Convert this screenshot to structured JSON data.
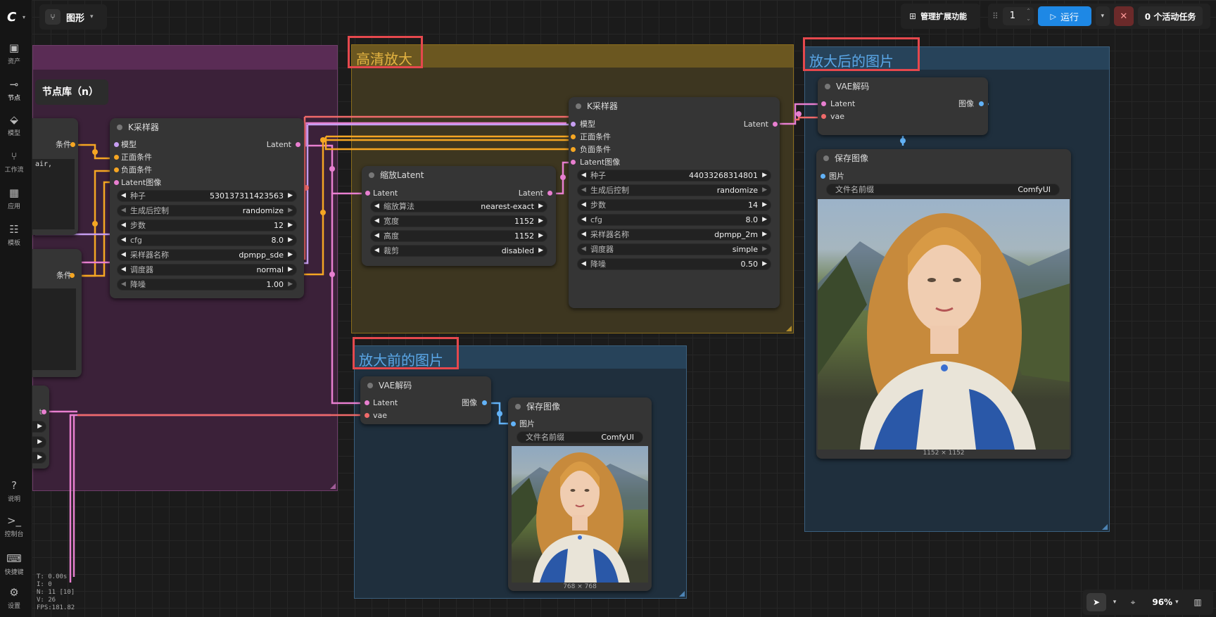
{
  "sidebar": {
    "logo": "C",
    "items": [
      {
        "icon": "image-icon",
        "label": "资产"
      },
      {
        "icon": "node-icon",
        "label": "节点"
      },
      {
        "icon": "model-icon",
        "label": "模型"
      },
      {
        "icon": "workflow-icon",
        "label": "工作流"
      },
      {
        "icon": "app-icon",
        "label": "应用"
      },
      {
        "icon": "template-icon",
        "label": "模板"
      }
    ],
    "bottom": [
      {
        "icon": "help-icon",
        "label": "说明"
      },
      {
        "icon": "console-icon",
        "label": "控制台"
      },
      {
        "icon": "keyboard-icon",
        "label": "快捷键"
      },
      {
        "icon": "gear-icon",
        "label": "设置"
      }
    ],
    "tooltip": "节点库（n）"
  },
  "topbar": {
    "graph_label": "图形",
    "manage_ext": "管理扩展功能",
    "run_count": "1",
    "run_label": "运行",
    "active_tasks": "0 个活动任务"
  },
  "stats": {
    "t": "T: 0.00s",
    "i": "I: 0",
    "n": "N: 11 [10]",
    "v": "V: 26",
    "fps": "FPS:181.82"
  },
  "zoom": "96%",
  "groups": {
    "hires": "高清放大",
    "after": "放大后的图片",
    "before": "放大前的图片"
  },
  "ksampler1": {
    "title": "K采样器",
    "inputs": [
      "模型",
      "正面条件",
      "负面条件",
      "Latent图像"
    ],
    "output": "Latent",
    "widgets": [
      {
        "label": "种子",
        "value": "530137311423563"
      },
      {
        "label": "生成后控制",
        "value": "randomize"
      },
      {
        "label": "步数",
        "value": "12"
      },
      {
        "label": "cfg",
        "value": "8.0"
      },
      {
        "label": "采样器名称",
        "value": "dpmpp_sde"
      },
      {
        "label": "调度器",
        "value": "normal"
      },
      {
        "label": "降噪",
        "value": "1.00"
      }
    ]
  },
  "left_nodes": {
    "cond1": "条件",
    "cond2": "条件",
    "text_snippet": "air,",
    "out_label": "t"
  },
  "scale": {
    "title": "缩放Latent",
    "input": "Latent",
    "output": "Latent",
    "widgets": [
      {
        "label": "缩放算法",
        "value": "nearest-exact"
      },
      {
        "label": "宽度",
        "value": "1152"
      },
      {
        "label": "高度",
        "value": "1152"
      },
      {
        "label": "裁剪",
        "value": "disabled"
      }
    ]
  },
  "ksampler2": {
    "title": "K采样器",
    "inputs": [
      "模型",
      "正面条件",
      "负面条件",
      "Latent图像"
    ],
    "output": "Latent",
    "widgets": [
      {
        "label": "种子",
        "value": "44033268314801"
      },
      {
        "label": "生成后控制",
        "value": "randomize"
      },
      {
        "label": "步数",
        "value": "14"
      },
      {
        "label": "cfg",
        "value": "8.0"
      },
      {
        "label": "采样器名称",
        "value": "dpmpp_2m"
      },
      {
        "label": "调度器",
        "value": "simple"
      },
      {
        "label": "降噪",
        "value": "0.50"
      }
    ]
  },
  "vae_after": {
    "title": "VAE解码",
    "in1": "Latent",
    "in2": "vae",
    "out": "图像"
  },
  "save_after": {
    "title": "保存图像",
    "input": "图片",
    "prefix_label": "文件名前缀",
    "prefix_value": "ComfyUI",
    "size": "1152 × 1152"
  },
  "vae_before": {
    "title": "VAE解码",
    "in1": "Latent",
    "in2": "vae",
    "out": "图像"
  },
  "save_before": {
    "title": "保存图像",
    "input": "图片",
    "prefix_label": "文件名前缀",
    "prefix_value": "ComfyUI",
    "size": "768 × 768"
  }
}
